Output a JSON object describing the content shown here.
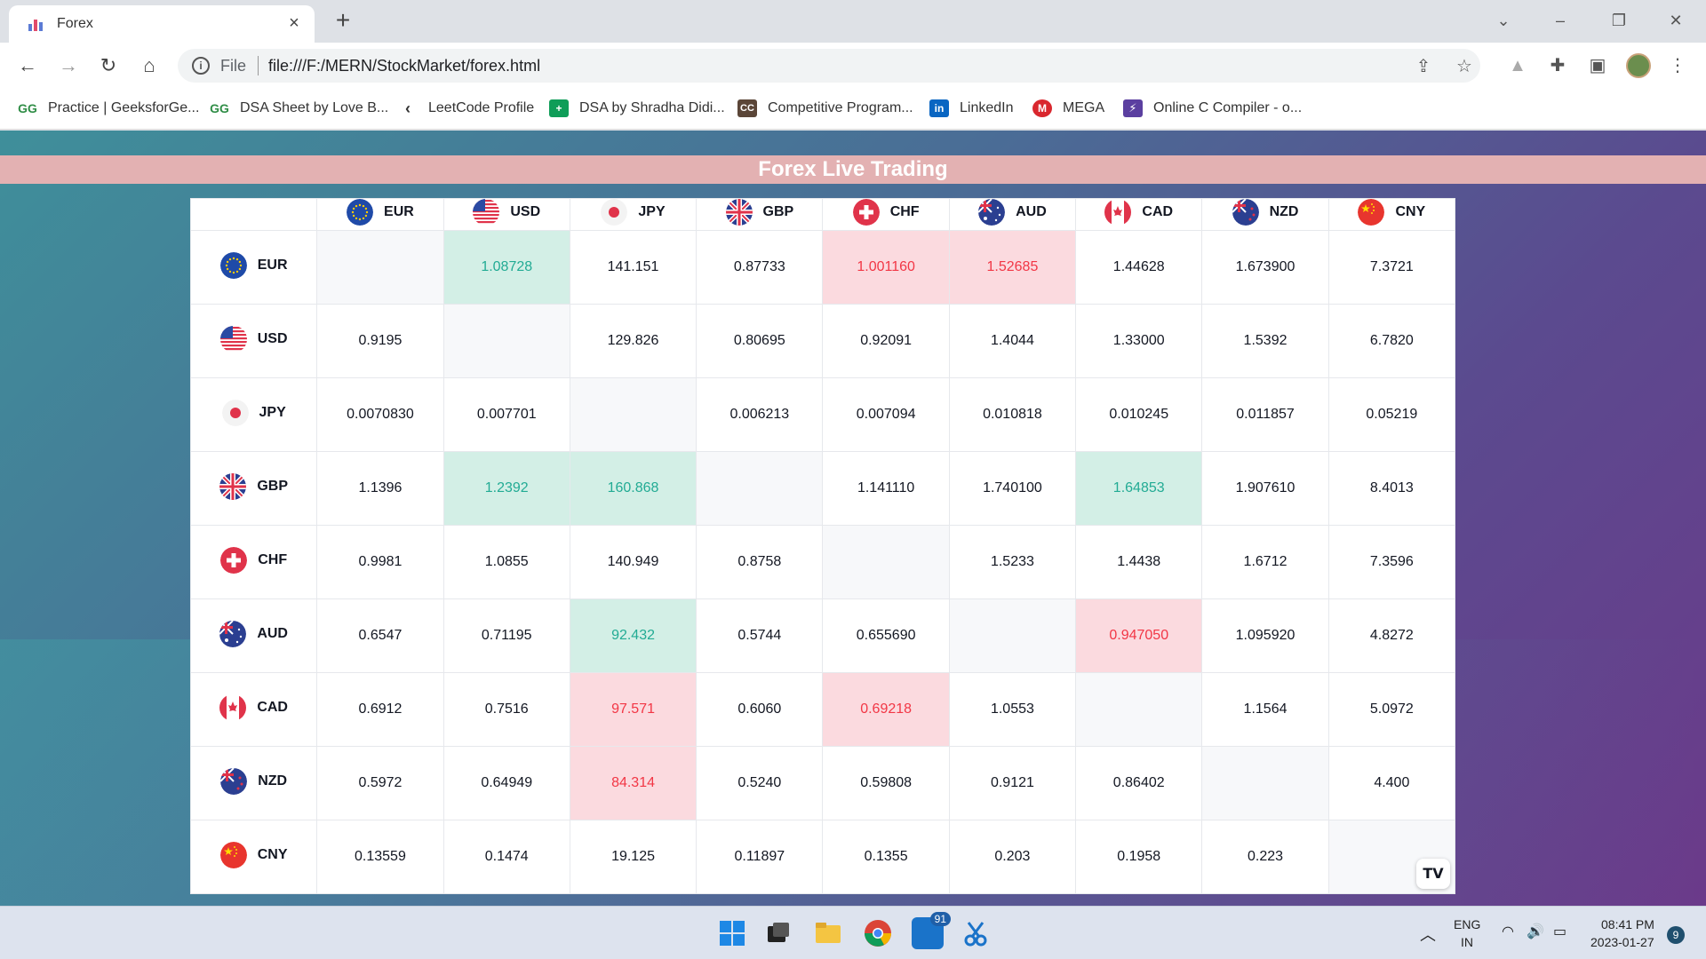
{
  "browser": {
    "tab_title": "Forex",
    "new_tab": "+",
    "scheme": "File",
    "url": "file:///F:/MERN/StockMarket/forex.html",
    "bookmarks": [
      {
        "label": "Practice | GeeksforGe...",
        "icon": "geeksforgeeks-icon"
      },
      {
        "label": "DSA Sheet by Love B...",
        "icon": "geeksforgeeks-icon"
      },
      {
        "label": "LeetCode Profile",
        "icon": "leetcode-icon"
      },
      {
        "label": "DSA by Shradha Didi...",
        "icon": "sheets-icon"
      },
      {
        "label": "Competitive Program...",
        "icon": "cc-icon"
      },
      {
        "label": "LinkedIn",
        "icon": "linkedin-icon"
      },
      {
        "label": "MEGA",
        "icon": "mega-icon"
      },
      {
        "label": "Online C Compiler - o...",
        "icon": "compiler-icon"
      }
    ]
  },
  "page": {
    "title": "Forex Live Trading",
    "widget_logo": "TV"
  },
  "currencies": [
    "EUR",
    "USD",
    "JPY",
    "GBP",
    "CHF",
    "AUD",
    "CAD",
    "NZD",
    "CNY"
  ],
  "rows": [
    {
      "base": "EUR",
      "cells": [
        {
          "v": "",
          "s": "diag"
        },
        {
          "v": "1.08728",
          "s": "up"
        },
        {
          "v": "141.151",
          "s": ""
        },
        {
          "v": "0.87733",
          "s": ""
        },
        {
          "v": "1.001160",
          "s": "down"
        },
        {
          "v": "1.52685",
          "s": "down"
        },
        {
          "v": "1.44628",
          "s": ""
        },
        {
          "v": "1.673900",
          "s": ""
        },
        {
          "v": "7.3721",
          "s": ""
        }
      ]
    },
    {
      "base": "USD",
      "cells": [
        {
          "v": "0.9195",
          "s": ""
        },
        {
          "v": "",
          "s": "diag"
        },
        {
          "v": "129.826",
          "s": ""
        },
        {
          "v": "0.80695",
          "s": ""
        },
        {
          "v": "0.92091",
          "s": ""
        },
        {
          "v": "1.4044",
          "s": ""
        },
        {
          "v": "1.33000",
          "s": ""
        },
        {
          "v": "1.5392",
          "s": ""
        },
        {
          "v": "6.7820",
          "s": ""
        }
      ]
    },
    {
      "base": "JPY",
      "cells": [
        {
          "v": "0.0070830",
          "s": ""
        },
        {
          "v": "0.007701",
          "s": ""
        },
        {
          "v": "",
          "s": "diag"
        },
        {
          "v": "0.006213",
          "s": ""
        },
        {
          "v": "0.007094",
          "s": ""
        },
        {
          "v": "0.010818",
          "s": ""
        },
        {
          "v": "0.010245",
          "s": ""
        },
        {
          "v": "0.011857",
          "s": ""
        },
        {
          "v": "0.05219",
          "s": ""
        }
      ]
    },
    {
      "base": "GBP",
      "cells": [
        {
          "v": "1.1396",
          "s": ""
        },
        {
          "v": "1.2392",
          "s": "up"
        },
        {
          "v": "160.868",
          "s": "up"
        },
        {
          "v": "",
          "s": "diag"
        },
        {
          "v": "1.141110",
          "s": ""
        },
        {
          "v": "1.740100",
          "s": ""
        },
        {
          "v": "1.64853",
          "s": "up"
        },
        {
          "v": "1.907610",
          "s": ""
        },
        {
          "v": "8.4013",
          "s": ""
        }
      ]
    },
    {
      "base": "CHF",
      "cells": [
        {
          "v": "0.9981",
          "s": ""
        },
        {
          "v": "1.0855",
          "s": ""
        },
        {
          "v": "140.949",
          "s": ""
        },
        {
          "v": "0.8758",
          "s": ""
        },
        {
          "v": "",
          "s": "diag"
        },
        {
          "v": "1.5233",
          "s": ""
        },
        {
          "v": "1.4438",
          "s": ""
        },
        {
          "v": "1.6712",
          "s": ""
        },
        {
          "v": "7.3596",
          "s": ""
        }
      ]
    },
    {
      "base": "AUD",
      "cells": [
        {
          "v": "0.6547",
          "s": ""
        },
        {
          "v": "0.71195",
          "s": ""
        },
        {
          "v": "92.432",
          "s": "up"
        },
        {
          "v": "0.5744",
          "s": ""
        },
        {
          "v": "0.655690",
          "s": ""
        },
        {
          "v": "",
          "s": "diag"
        },
        {
          "v": "0.947050",
          "s": "down"
        },
        {
          "v": "1.095920",
          "s": ""
        },
        {
          "v": "4.8272",
          "s": ""
        }
      ]
    },
    {
      "base": "CAD",
      "cells": [
        {
          "v": "0.6912",
          "s": ""
        },
        {
          "v": "0.7516",
          "s": ""
        },
        {
          "v": "97.571",
          "s": "down"
        },
        {
          "v": "0.6060",
          "s": ""
        },
        {
          "v": "0.69218",
          "s": "down"
        },
        {
          "v": "1.0553",
          "s": ""
        },
        {
          "v": "",
          "s": "diag"
        },
        {
          "v": "1.1564",
          "s": ""
        },
        {
          "v": "5.0972",
          "s": ""
        }
      ]
    },
    {
      "base": "NZD",
      "cells": [
        {
          "v": "0.5972",
          "s": ""
        },
        {
          "v": "0.64949",
          "s": ""
        },
        {
          "v": "84.314",
          "s": "down"
        },
        {
          "v": "0.5240",
          "s": ""
        },
        {
          "v": "0.59808",
          "s": ""
        },
        {
          "v": "0.9121",
          "s": ""
        },
        {
          "v": "0.86402",
          "s": ""
        },
        {
          "v": "",
          "s": "diag"
        },
        {
          "v": "4.400",
          "s": ""
        }
      ]
    },
    {
      "base": "CNY",
      "cells": [
        {
          "v": "0.13559",
          "s": ""
        },
        {
          "v": "0.1474",
          "s": ""
        },
        {
          "v": "19.125",
          "s": ""
        },
        {
          "v": "0.11897",
          "s": ""
        },
        {
          "v": "0.1355",
          "s": ""
        },
        {
          "v": "0.203",
          "s": ""
        },
        {
          "v": "0.1958",
          "s": ""
        },
        {
          "v": "0.223",
          "s": ""
        },
        {
          "v": "",
          "s": "diag"
        }
      ]
    }
  ],
  "colors": {
    "up_bg": "#d3efe6",
    "up_text": "#22ab94",
    "down_bg": "#fbdadf",
    "down_text": "#f23645",
    "banner": "#e3b1b2"
  },
  "taskbar": {
    "mail_badge": "91",
    "lang_line1": "ENG",
    "lang_line2": "IN",
    "time": "08:41 PM",
    "date": "2023-01-27",
    "notifications": "9"
  }
}
